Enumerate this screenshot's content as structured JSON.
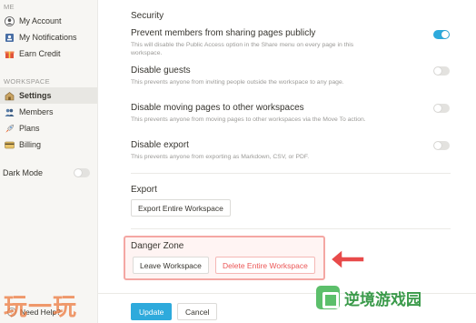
{
  "sidebar": {
    "me_label": "ME",
    "me_items": [
      {
        "label": "My Account",
        "icon": "account-icon"
      },
      {
        "label": "My Notifications",
        "icon": "notifications-icon"
      },
      {
        "label": "Earn Credit",
        "icon": "gift-icon"
      }
    ],
    "workspace_label": "WORKSPACE",
    "workspace_items": [
      {
        "label": "Settings",
        "icon": "settings-icon",
        "active": true
      },
      {
        "label": "Members",
        "icon": "members-icon"
      },
      {
        "label": "Plans",
        "icon": "rocket-icon"
      },
      {
        "label": "Billing",
        "icon": "card-icon"
      }
    ],
    "dark_mode": {
      "label": "Dark Mode",
      "enabled": false
    },
    "help": "Need Help?"
  },
  "main": {
    "security_heading": "Security",
    "options": [
      {
        "title": "Prevent members from sharing pages publicly",
        "description": "This will disable the Public Access option in the Share menu on every page in this workspace.",
        "enabled": true
      },
      {
        "title": "Disable guests",
        "description": "This prevents anyone from inviting people outside the workspace to any page.",
        "enabled": false
      },
      {
        "title": "Disable moving pages to other workspaces",
        "description": "This prevents anyone from moving pages to other workspaces via the Move To action.",
        "enabled": false
      },
      {
        "title": "Disable export",
        "description": "This prevents anyone from exporting as Markdown, CSV, or PDF.",
        "enabled": false
      }
    ],
    "export_heading": "Export",
    "export_button": "Export Entire Workspace",
    "danger_heading": "Danger Zone",
    "leave_button": "Leave Workspace",
    "delete_button": "Delete Entire Workspace",
    "update_button": "Update",
    "cancel_button": "Cancel"
  },
  "colors": {
    "accent": "#2eaadc",
    "danger": "#eb5757",
    "highlight": "#f4a7a3"
  },
  "watermarks": {
    "left": "玩一玩",
    "right": "逆境游戏园"
  }
}
